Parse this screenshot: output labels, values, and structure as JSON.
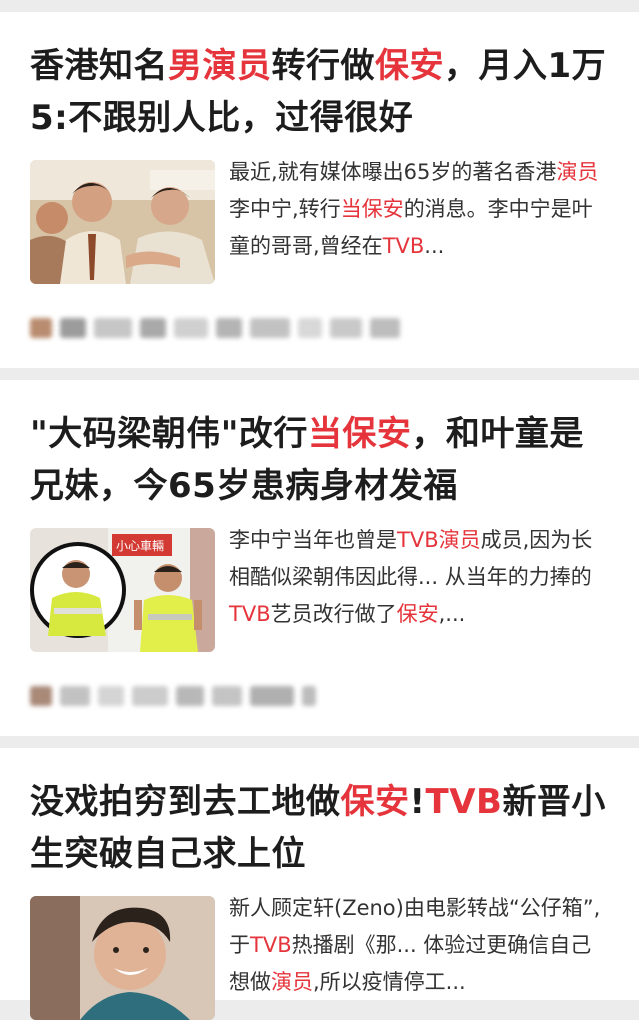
{
  "feed": {
    "cards": [
      {
        "title": [
          {
            "t": "香港知名",
            "hl": false
          },
          {
            "t": "男演员",
            "hl": true
          },
          {
            "t": "转行做",
            "hl": false
          },
          {
            "t": "保安",
            "hl": true
          },
          {
            "t": "，月入1万5:不跟别人比，过得很好",
            "hl": false
          }
        ],
        "snippet": [
          {
            "t": "最近,就有媒体曝出65岁的著名香港",
            "hl": false
          },
          {
            "t": "演员",
            "hl": true
          },
          {
            "t": "李中宁,转行",
            "hl": false
          },
          {
            "t": "当保安",
            "hl": true
          },
          {
            "t": "的消息。李中宁是叶童的哥哥,曾经在",
            "hl": false
          },
          {
            "t": "TVB",
            "hl": true
          },
          {
            "t": "...",
            "hl": false
          }
        ],
        "thumb_icon": "photo-two-men-icon"
      },
      {
        "title": [
          {
            "t": "\"大码梁朝伟\"改行",
            "hl": false
          },
          {
            "t": "当保安",
            "hl": true
          },
          {
            "t": "，和叶童是兄妹，今65岁患病身材发福",
            "hl": false
          }
        ],
        "snippet": [
          {
            "t": "李中宁当年也曾是",
            "hl": false
          },
          {
            "t": "TVB演员",
            "hl": true
          },
          {
            "t": "成员,因为长相酷似梁朝伟因此得... 从当年的力捧的",
            "hl": false
          },
          {
            "t": "TVB",
            "hl": true
          },
          {
            "t": "艺员改行做了",
            "hl": false
          },
          {
            "t": "保安",
            "hl": true
          },
          {
            "t": ",...",
            "hl": false
          }
        ],
        "thumb_sign": "小心車輛",
        "thumb_icon": "photo-security-guard-icon"
      },
      {
        "title": [
          {
            "t": "没戏拍穷到去工地做",
            "hl": false
          },
          {
            "t": "保安",
            "hl": true
          },
          {
            "t": "!",
            "hl": false
          },
          {
            "t": "TVB",
            "hl": true
          },
          {
            "t": "新晋小生突破自己求上位",
            "hl": false
          }
        ],
        "snippet": [
          {
            "t": "新人顾定轩(Zeno)由电影转战“公仔箱”,于",
            "hl": false
          },
          {
            "t": "TVB",
            "hl": true
          },
          {
            "t": "热播剧《那... 体验过更确信自己想做",
            "hl": false
          },
          {
            "t": "演员",
            "hl": true
          },
          {
            "t": ",所以疫情停工...",
            "hl": false
          }
        ],
        "thumb_icon": "photo-smiling-man-icon"
      }
    ]
  },
  "colors": {
    "highlight": "#e5343b",
    "background": "#ececec",
    "card": "#ffffff"
  }
}
